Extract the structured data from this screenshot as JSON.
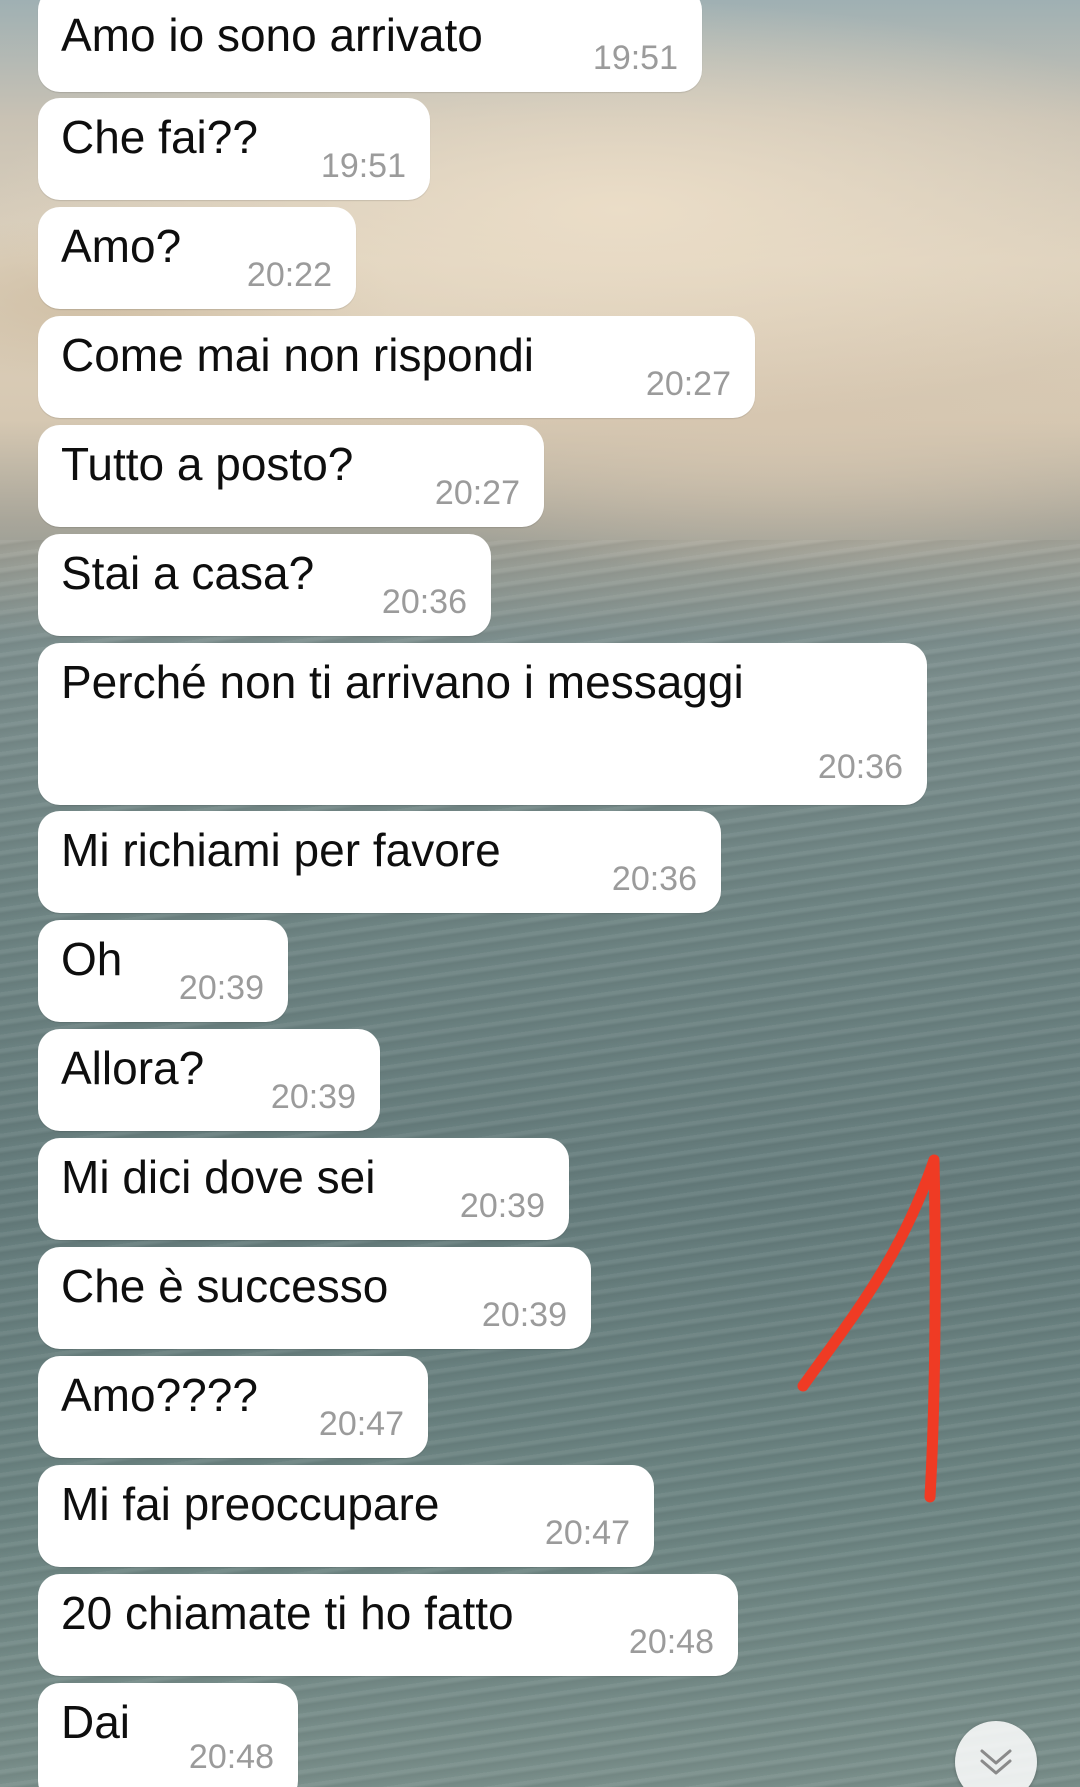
{
  "messages": [
    {
      "text": "Amo io sono arrivato",
      "time": "19:51"
    },
    {
      "text": "Che fai??",
      "time": "19:51"
    },
    {
      "text": "Amo?",
      "time": "20:22"
    },
    {
      "text": "Come mai non rispondi",
      "time": "20:27"
    },
    {
      "text": "Tutto a posto?",
      "time": "20:27"
    },
    {
      "text": "Stai a casa?",
      "time": "20:36"
    },
    {
      "text": "Perché non ti arrivano i messaggi",
      "time": "20:36"
    },
    {
      "text": "Mi richiami per favore",
      "time": "20:36"
    },
    {
      "text": "Oh",
      "time": "20:39"
    },
    {
      "text": "Allora?",
      "time": "20:39"
    },
    {
      "text": "Mi dici dove sei",
      "time": "20:39"
    },
    {
      "text": "Che è successo",
      "time": "20:39"
    },
    {
      "text": "Amo????",
      "time": "20:47"
    },
    {
      "text": "Mi fai preoccupare",
      "time": "20:47"
    },
    {
      "text": "20 chiamate ti ho fatto",
      "time": "20:48"
    },
    {
      "text": "Dai",
      "time": "20:48"
    }
  ],
  "colors": {
    "bubble": "#ffffff",
    "text": "#0e0e0e",
    "time": "#9b9b9b",
    "annotation": "#ef3b24"
  },
  "icons": {
    "scroll_down": "double-chevron-down-icon",
    "annotation": "red-arrow-drawing"
  }
}
